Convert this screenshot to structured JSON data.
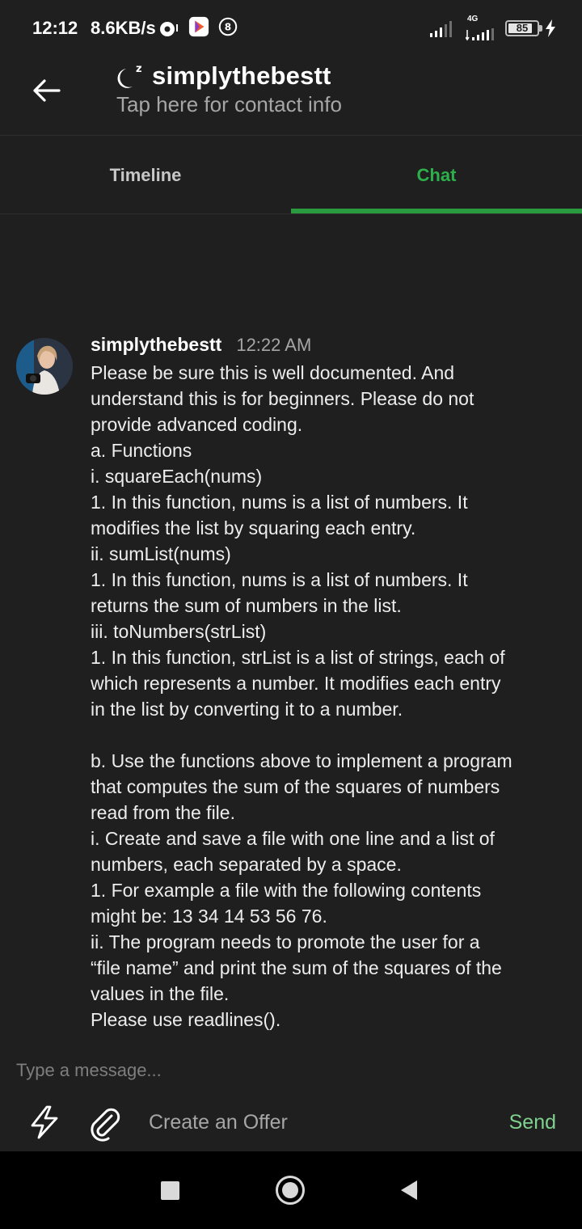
{
  "status_bar": {
    "time": "12:12",
    "net_speed": "8.6KB/s",
    "network_type": "4G",
    "battery": "85",
    "battery_fraction": 0.85
  },
  "header": {
    "title": "simplythebestt",
    "subtitle": "Tap here for contact info"
  },
  "tabs": [
    {
      "label": "Timeline",
      "active": false
    },
    {
      "label": "Chat",
      "active": true
    }
  ],
  "message": {
    "sender": "simplythebestt",
    "time": "12:22 AM",
    "lines": [
      "Please be sure this is well documented. And",
      "understand this is for beginners. Please do not",
      "provide advanced coding.",
      "a. Functions",
      "i. squareEach(nums)",
      "1. In this function, nums is a list of numbers. It",
      "modifies the list by squaring each entry.",
      "ii. sumList(nums)",
      "1. In this function, nums is a list of numbers. It",
      "returns the sum of numbers in the list.",
      "iii. toNumbers(strList)",
      "1. In this function, strList is a list of strings, each of",
      "which represents a number. It modifies each entry",
      "in the list by converting it to a number.",
      "",
      "b. Use the functions above to implement a program",
      "that computes the sum of the squares of numbers",
      "read from the file.",
      "i. Create and save a file with one line and a list of",
      "numbers, each separated by a space.",
      "1. For example a file with the following contents",
      "might be: 13 34 14 53 56 76.",
      "ii. The program needs to promote the user for a",
      "“file name” and print the sum of the squares of the",
      "values in the file.",
      "Please use readlines()."
    ]
  },
  "composer": {
    "placeholder": "Type a message...",
    "offer_label": "Create an Offer",
    "send_label": "Send"
  },
  "colors": {
    "background": "#1f1f1f",
    "accent_green": "#2db04b",
    "send_green": "#7fd18f",
    "muted_text": "#a6a6a6"
  },
  "icons": {
    "back": "arrow-left-icon",
    "status_logo": "moon-z-icon",
    "bolt": "bolt-icon",
    "attach": "paperclip-icon"
  }
}
